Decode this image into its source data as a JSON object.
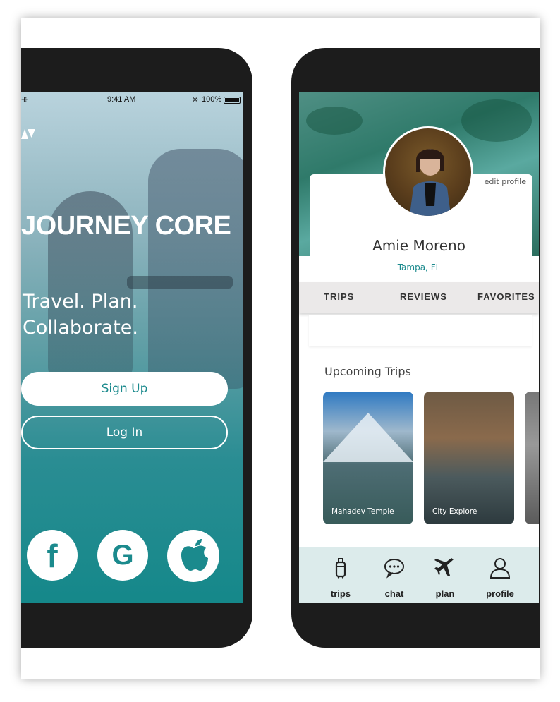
{
  "login_screen": {
    "status_bar": {
      "time": "9:41 AM",
      "battery": "100%"
    },
    "brand": "JOURNEY CORE",
    "tagline_line1": "Travel. Plan.",
    "tagline_line2": "Collaborate.",
    "signup_label": "Sign Up",
    "login_label": "Log In",
    "social": [
      {
        "icon": "facebook-icon",
        "glyph": "f"
      },
      {
        "icon": "google-icon",
        "glyph": "G"
      },
      {
        "icon": "apple-icon"
      }
    ],
    "colors": {
      "accent": "#1b8a8d",
      "background_top": "#b9d3dd",
      "background_bottom": "#15888a"
    }
  },
  "profile_screen": {
    "edit_profile": "edit profile",
    "name": "Amie Moreno",
    "location": "Tampa, FL",
    "tabs": [
      "TRIPS",
      "REVIEWS",
      "FAVORITES"
    ],
    "section_title": "Upcoming Trips",
    "trips": [
      {
        "label": "Mahadev Temple"
      },
      {
        "label": "City Explore"
      },
      {
        "label": ""
      }
    ],
    "bottom_nav": [
      {
        "label": "trips",
        "icon": "luggage-icon"
      },
      {
        "label": "chat",
        "icon": "chat-bubble-icon"
      },
      {
        "label": "plan",
        "icon": "airplane-icon"
      },
      {
        "label": "profile",
        "icon": "user-icon"
      }
    ],
    "colors": {
      "accent": "#1b8a8d",
      "nav_background": "#dcebeb",
      "tab_background": "#ebe9e9"
    }
  }
}
